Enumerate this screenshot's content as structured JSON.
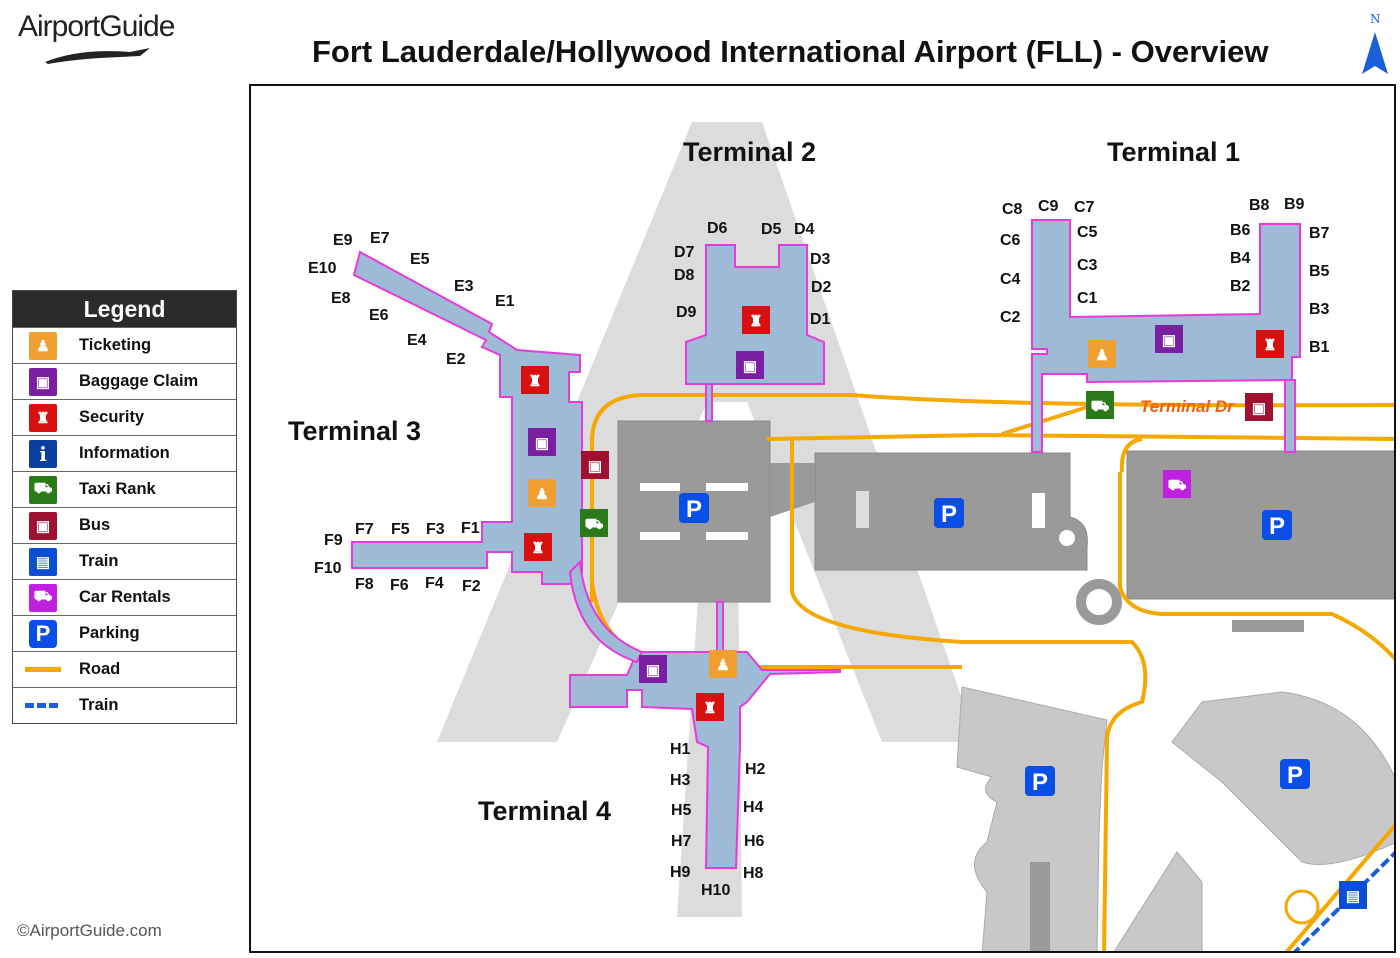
{
  "logo": {
    "text": "AirportGuide"
  },
  "header": {
    "title": "Fort Lauderdale/Hollywood International Airport (FLL) - Overview",
    "north_label": "N"
  },
  "legend": {
    "title": "Legend",
    "items": [
      {
        "label": "Ticketing",
        "icon": "ticketing-icon",
        "color": "#f0a030"
      },
      {
        "label": "Baggage Claim",
        "icon": "baggage-claim-icon",
        "color": "#7a1fa2"
      },
      {
        "label": "Security",
        "icon": "security-icon",
        "color": "#d91010"
      },
      {
        "label": "Information",
        "icon": "information-icon",
        "color": "#0a3fa0"
      },
      {
        "label": "Taxi Rank",
        "icon": "taxi-icon",
        "color": "#2a7a1a"
      },
      {
        "label": "Bus",
        "icon": "bus-icon",
        "color": "#a01030"
      },
      {
        "label": "Train",
        "icon": "train-icon",
        "color": "#0a4ed8"
      },
      {
        "label": "Car Rentals",
        "icon": "car-rental-icon",
        "color": "#c020e0"
      },
      {
        "label": "Parking",
        "icon": "parking-icon",
        "color": "#0a4ee8"
      },
      {
        "label": "Road",
        "icon": "road-line",
        "color": "#f5a800"
      },
      {
        "label": "Train",
        "icon": "train-line",
        "color": "#1a5fd8"
      }
    ]
  },
  "terminals": [
    {
      "name": "Terminal 1",
      "gates": [
        "B1",
        "B2",
        "B3",
        "B4",
        "B5",
        "B6",
        "B7",
        "B8",
        "B9",
        "C1",
        "C2",
        "C3",
        "C4",
        "C5",
        "C6",
        "C7",
        "C8",
        "C9"
      ]
    },
    {
      "name": "Terminal 2",
      "gates": [
        "D1",
        "D2",
        "D3",
        "D4",
        "D5",
        "D6",
        "D7",
        "D8",
        "D9"
      ]
    },
    {
      "name": "Terminal 3",
      "gates": [
        "E1",
        "E2",
        "E3",
        "E4",
        "E5",
        "E6",
        "E7",
        "E8",
        "E9",
        "E10",
        "F1",
        "F2",
        "F3",
        "F4",
        "F5",
        "F6",
        "F7",
        "F8",
        "F9",
        "F10"
      ]
    },
    {
      "name": "Terminal 4",
      "gates": [
        "H1",
        "H2",
        "H3",
        "H4",
        "H5",
        "H6",
        "H7",
        "H8",
        "H9",
        "H10"
      ]
    }
  ],
  "road_label": "Terminal Dr",
  "parking_symbol": "P",
  "copyright": "©AirportGuide.com",
  "colors": {
    "terminal_fill": "#9dbad6",
    "terminal_border": "#e83ad8",
    "garage": "#9a9a9a",
    "lot": "#c8c8c8",
    "road": "#f5a800",
    "train": "#1a5fd8"
  }
}
